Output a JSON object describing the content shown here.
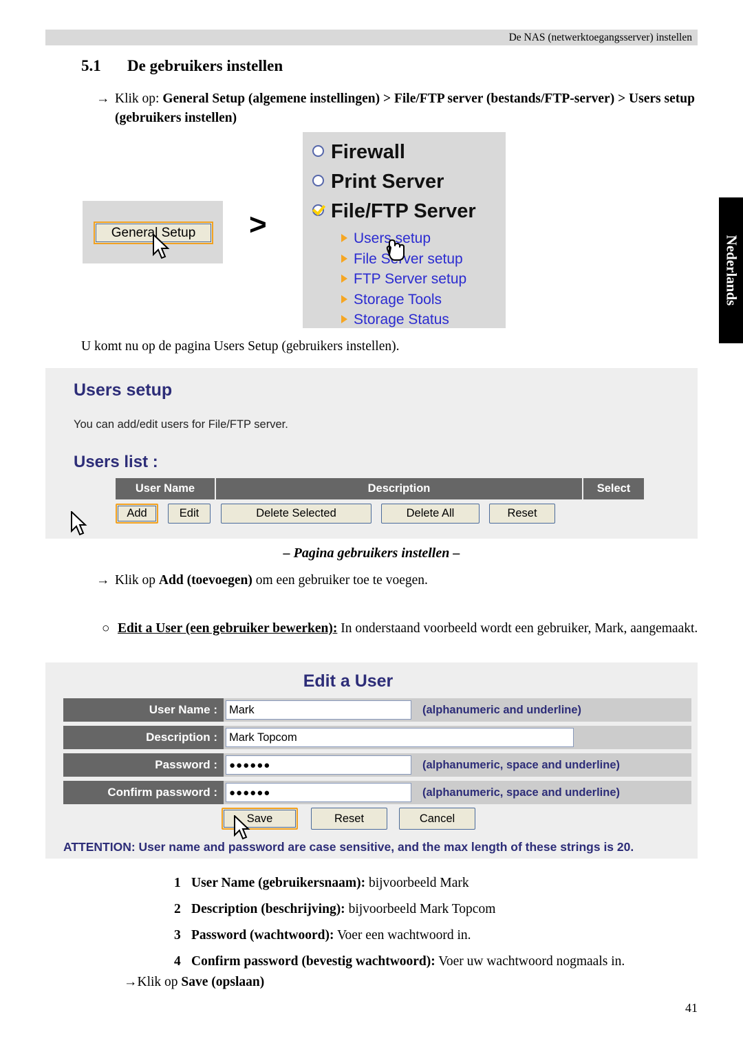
{
  "header": {
    "running_head": "De NAS (netwerktoegangsserver) instellen",
    "page_number": "41"
  },
  "section": {
    "number": "5.1",
    "title": "De gebruikers instellen"
  },
  "instructions": {
    "arrow_glyph": "→",
    "step1_prefix": "Klik op: ",
    "step1_bold": "General Setup (algemene instellingen) > File/FTP server (bestands/FTP-server) > Users setup (gebruikers instellen)",
    "after_fig1": "U komt nu op de pagina Users Setup (gebruikers instellen).",
    "fig2_caption": "– Pagina gebruikers instellen –",
    "step2_prefix": "Klik op ",
    "step2_bold": "Add (toevoegen)",
    "step2_suffix": " om een gebruiker toe te voegen.",
    "bullet_glyph": "○",
    "step3_bold": "Edit a User (een gebruiker bewerken):",
    "step3_rest": " In onderstaand voorbeeld wordt een gebruiker, Mark, aangemaakt.",
    "final_prefix": "Klik op ",
    "final_bold": "Save (opslaan)"
  },
  "figure_menu": {
    "general_setup_button": "General Setup",
    "greater_than": ">",
    "top_items": [
      {
        "label": "Firewall",
        "checked": false
      },
      {
        "label": "Print Server",
        "checked": false
      },
      {
        "label": "File/FTP Server",
        "checked": true
      }
    ],
    "sub_links": [
      "Users setup",
      "File Server setup",
      "FTP Server setup",
      "Storage Tools",
      "Storage Status"
    ],
    "colors": {
      "panel_bg": "#d9d9d9",
      "link": "#2b2bd0",
      "bullet": "#f5a623",
      "highlight": "#f0a020"
    }
  },
  "figure_users_setup": {
    "title": "Users setup",
    "description": "You can add/edit users for File/FTP server.",
    "list_label": "Users list  :",
    "table_headers": [
      "User Name",
      "Description",
      "Select"
    ],
    "table_rows": [],
    "buttons": [
      {
        "label": "Add",
        "highlighted": true
      },
      {
        "label": "Edit",
        "highlighted": false
      },
      {
        "label": "Delete Selected",
        "highlighted": false
      },
      {
        "label": "Delete All",
        "highlighted": false
      },
      {
        "label": "Reset",
        "highlighted": false
      }
    ],
    "colors": {
      "panel_bg": "#eeeeee",
      "header_row": "#666666",
      "title": "#2d2d78"
    }
  },
  "figure_edit_user": {
    "title": "Edit a User",
    "fields": [
      {
        "label": "User Name  :",
        "value": "Mark",
        "hint": "(alphanumeric and underline)",
        "masked": false
      },
      {
        "label": "Description  :",
        "value": "Mark Topcom",
        "hint": "",
        "masked": false
      },
      {
        "label": "Password  :",
        "value": "●●●●●●",
        "hint": "(alphanumeric, space and underline)",
        "masked": true
      },
      {
        "label": "Confirm password  :",
        "value": "●●●●●●",
        "hint": "(alphanumeric, space and underline)",
        "masked": true
      }
    ],
    "buttons": [
      {
        "label": "Save",
        "highlighted": true
      },
      {
        "label": "Reset",
        "highlighted": false
      },
      {
        "label": "Cancel",
        "highlighted": false
      }
    ],
    "attention": "ATTENTION: User name and password are case sensitive, and the max length of these strings is 20.",
    "colors": {
      "panel_bg": "#eeeeee",
      "label_bg": "#666666",
      "row_bg": "#cccccc",
      "accent": "#2d2d78"
    }
  },
  "numbered_list": [
    {
      "num": "1",
      "bold": "User Name (gebruikersnaam):",
      "rest": " bijvoorbeeld Mark"
    },
    {
      "num": "2",
      "bold": "Description (beschrijving):",
      "rest": " bijvoorbeeld Mark Topcom"
    },
    {
      "num": "3",
      "bold": "Password (wachtwoord):",
      "rest": " Voer een wachtwoord in."
    },
    {
      "num": "4",
      "bold": "Confirm password (bevestig wachtwoord):",
      "rest": " Voer uw wachtwoord nogmaals in."
    }
  ],
  "side_tab": {
    "label": "Nederlands"
  }
}
